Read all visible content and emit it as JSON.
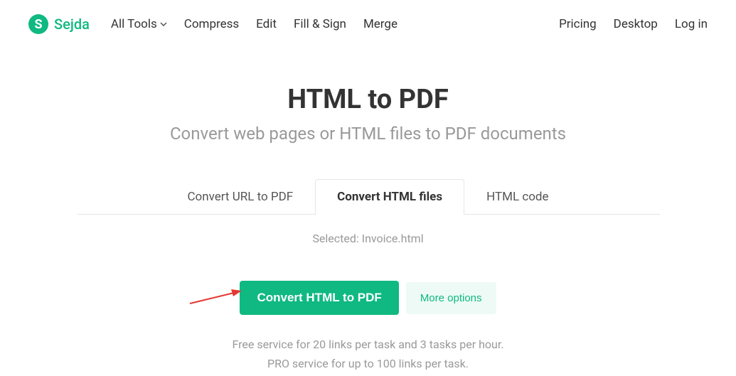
{
  "logo": {
    "letter": "S",
    "text": "Sejda"
  },
  "nav": {
    "allTools": "All Tools",
    "compress": "Compress",
    "edit": "Edit",
    "fillSign": "Fill & Sign",
    "merge": "Merge"
  },
  "rightNav": {
    "pricing": "Pricing",
    "desktop": "Desktop",
    "login": "Log in"
  },
  "main": {
    "title": "HTML to PDF",
    "subtitle": "Convert web pages or HTML files to PDF documents"
  },
  "tabs": {
    "url": "Convert URL to PDF",
    "htmlFiles": "Convert HTML files",
    "htmlCode": "HTML code"
  },
  "selected": "Selected: Invoice.html",
  "actions": {
    "convert": "Convert HTML to PDF",
    "moreOptions": "More options"
  },
  "footnote": {
    "line1": "Free service for 20 links per task and 3 tasks per hour.",
    "line2": "PRO service for up to 100 links per task."
  }
}
